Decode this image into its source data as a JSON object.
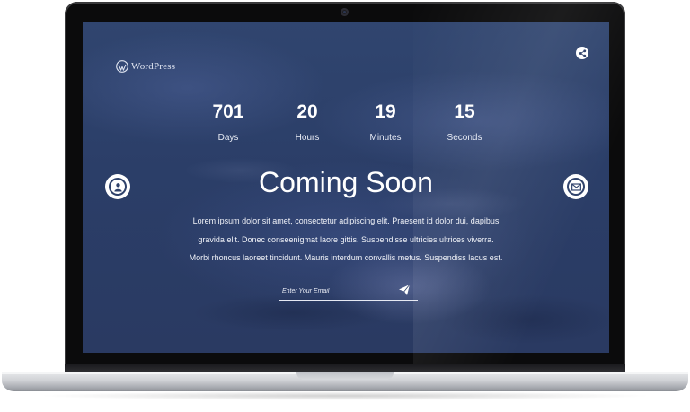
{
  "site": {
    "logo_text": "WordPress",
    "logo_icon": "wordpress-logo-icon"
  },
  "header": {
    "share_icon": "share-icon"
  },
  "countdown": [
    {
      "value": "701",
      "label": "Days"
    },
    {
      "value": "20",
      "label": "Hours"
    },
    {
      "value": "19",
      "label": "Minutes"
    },
    {
      "value": "15",
      "label": "Seconds"
    }
  ],
  "side": {
    "left_icon": "user-icon",
    "right_icon": "envelope-icon"
  },
  "main": {
    "title": "Coming Soon",
    "description_lines": [
      "Lorem ipsum dolor sit amet, consectetur adipiscing elit. Praesent id dolor dui, dapibus",
      "gravida elit. Donec conseenigmat laore gittis. Suspendisse ultricies ultrices viverra.",
      "Morbi rhoncus laoreet tincidunt. Mauris interdum convallis metus. Suspendiss lacus est."
    ]
  },
  "subscribe": {
    "email_placeholder": "Enter Your Email",
    "email_value": "",
    "send_icon": "paper-plane-icon"
  },
  "colors": {
    "background": "#2b3e68",
    "text": "#ffffff",
    "bezel": "#0b0b0c"
  }
}
